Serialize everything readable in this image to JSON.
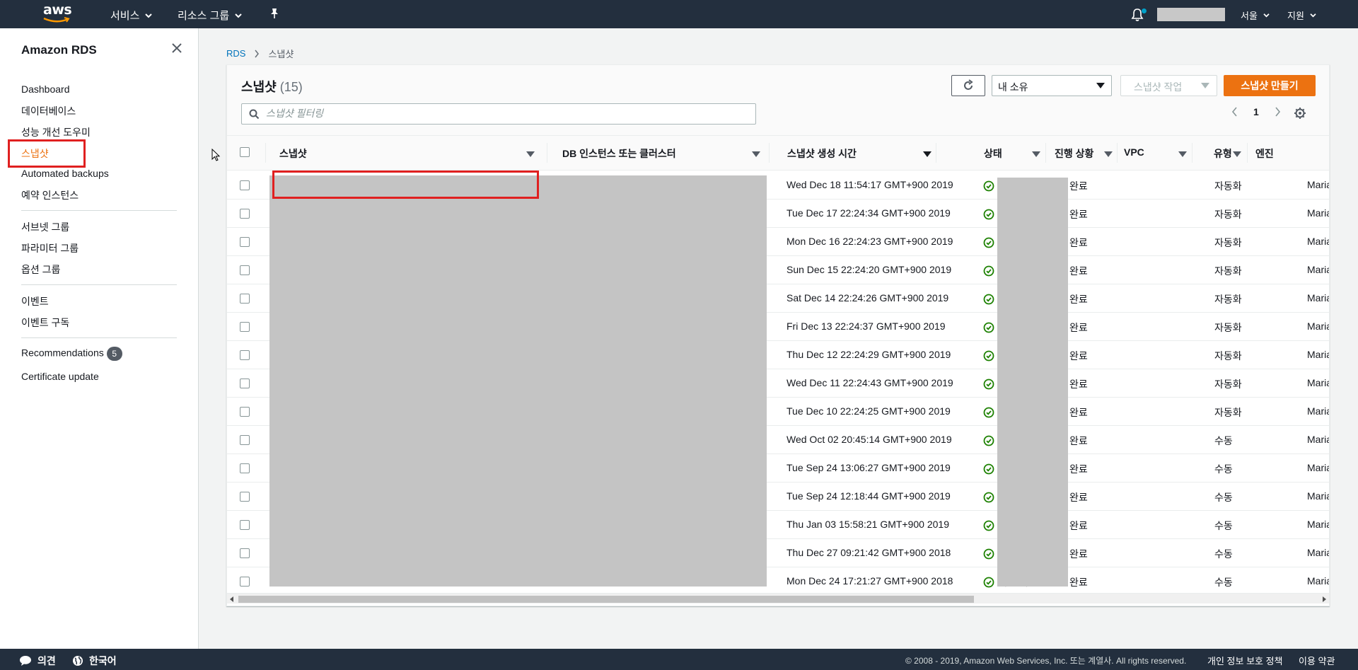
{
  "topnav": {
    "logo_text": "aws",
    "services_label": "서비스",
    "resource_groups_label": "리소스 그룹",
    "region_label": "서울",
    "support_label": "지원"
  },
  "sidebar": {
    "title": "Amazon RDS",
    "items": [
      {
        "label": "Dashboard"
      },
      {
        "label": "데이터베이스"
      },
      {
        "label": "성능 개선 도우미"
      },
      {
        "label": "스냅샷"
      },
      {
        "label": "Automated backups"
      },
      {
        "label": "예약 인스턴스"
      },
      {
        "label": "서브넷 그룹"
      },
      {
        "label": "파라미터 그룹"
      },
      {
        "label": "옵션 그룹"
      },
      {
        "label": "이벤트"
      },
      {
        "label": "이벤트 구독"
      },
      {
        "label": "Recommendations",
        "badge": "5"
      },
      {
        "label": "Certificate update"
      }
    ]
  },
  "breadcrumb": {
    "root": "RDS",
    "current": "스냅샷"
  },
  "panel": {
    "title": "스냅샷",
    "count": "(15)",
    "owner_select": "내 소유",
    "actions_label": "스냅샷 작업",
    "create_label": "스냅샷 만들기",
    "search_placeholder": "스냅샷 필터링",
    "page_number": "1"
  },
  "table": {
    "columns": [
      "스냅샷",
      "DB 인스턴스 또는 클러스터",
      "스냅샷 생성 시간",
      "상태",
      "진행 상황",
      "VPC",
      "유형",
      "엔진"
    ],
    "rows": [
      {
        "created": "Wed Dec 18 11:54:17 GMT+900 2019",
        "status": "사용 가능",
        "progress": "완료",
        "type": "자동화",
        "engine": "Maria"
      },
      {
        "created": "Tue Dec 17 22:24:34 GMT+900 2019",
        "status": "사용 가능",
        "progress": "완료",
        "type": "자동화",
        "engine": "Maria"
      },
      {
        "created": "Mon Dec 16 22:24:23 GMT+900 2019",
        "status": "사용 가능",
        "progress": "완료",
        "type": "자동화",
        "engine": "Maria"
      },
      {
        "created": "Sun Dec 15 22:24:20 GMT+900 2019",
        "status": "사용 가능",
        "progress": "완료",
        "type": "자동화",
        "engine": "Maria"
      },
      {
        "created": "Sat Dec 14 22:24:26 GMT+900 2019",
        "status": "사용 가능",
        "progress": "완료",
        "type": "자동화",
        "engine": "Maria"
      },
      {
        "created": "Fri Dec 13 22:24:37 GMT+900 2019",
        "status": "사용 가능",
        "progress": "완료",
        "type": "자동화",
        "engine": "Maria"
      },
      {
        "created": "Thu Dec 12 22:24:29 GMT+900 2019",
        "status": "사용 가능",
        "progress": "완료",
        "type": "자동화",
        "engine": "Maria"
      },
      {
        "created": "Wed Dec 11 22:24:43 GMT+900 2019",
        "status": "사용 가능",
        "progress": "완료",
        "type": "자동화",
        "engine": "Maria"
      },
      {
        "created": "Tue Dec 10 22:24:25 GMT+900 2019",
        "status": "사용 가능",
        "progress": "완료",
        "type": "자동화",
        "engine": "Maria"
      },
      {
        "created": "Wed Oct 02 20:45:14 GMT+900 2019",
        "status": "사용 가능",
        "progress": "완료",
        "type": "수동",
        "engine": "Maria"
      },
      {
        "created": "Tue Sep 24 13:06:27 GMT+900 2019",
        "status": "사용 가능",
        "progress": "완료",
        "type": "수동",
        "engine": "Maria"
      },
      {
        "created": "Tue Sep 24 12:18:44 GMT+900 2019",
        "status": "사용 가능",
        "progress": "완료",
        "type": "수동",
        "engine": "Maria"
      },
      {
        "created": "Thu Jan 03 15:58:21 GMT+900 2019",
        "status": "사용 가능",
        "progress": "완료",
        "type": "수동",
        "engine": "Maria"
      },
      {
        "created": "Thu Dec 27 09:21:42 GMT+900 2018",
        "status": "사용 가능",
        "progress": "완료",
        "type": "수동",
        "engine": "Maria"
      },
      {
        "created": "Mon Dec 24 17:21:27 GMT+900 2018",
        "status": "사용 가능",
        "progress": "완료",
        "type": "수동",
        "engine": "Maria"
      }
    ]
  },
  "footer": {
    "feedback_label": "의견",
    "language_label": "한국어",
    "copyright": "© 2008 - 2019, Amazon Web Services, Inc. 또는 계열사. All rights reserved.",
    "privacy_label": "개인 정보 보호 정책",
    "terms_label": "이용 약관"
  },
  "colors": {
    "nav_bg": "#232f3e",
    "accent": "#ec7211",
    "link": "#0073bb",
    "success": "#1d8102",
    "highlight_box": "#e02020"
  },
  "icons": [
    "bell-icon",
    "pin-icon",
    "close-icon",
    "refresh-icon",
    "search-icon",
    "gear-icon",
    "status-ok-icon",
    "chat-icon",
    "globe-icon"
  ]
}
